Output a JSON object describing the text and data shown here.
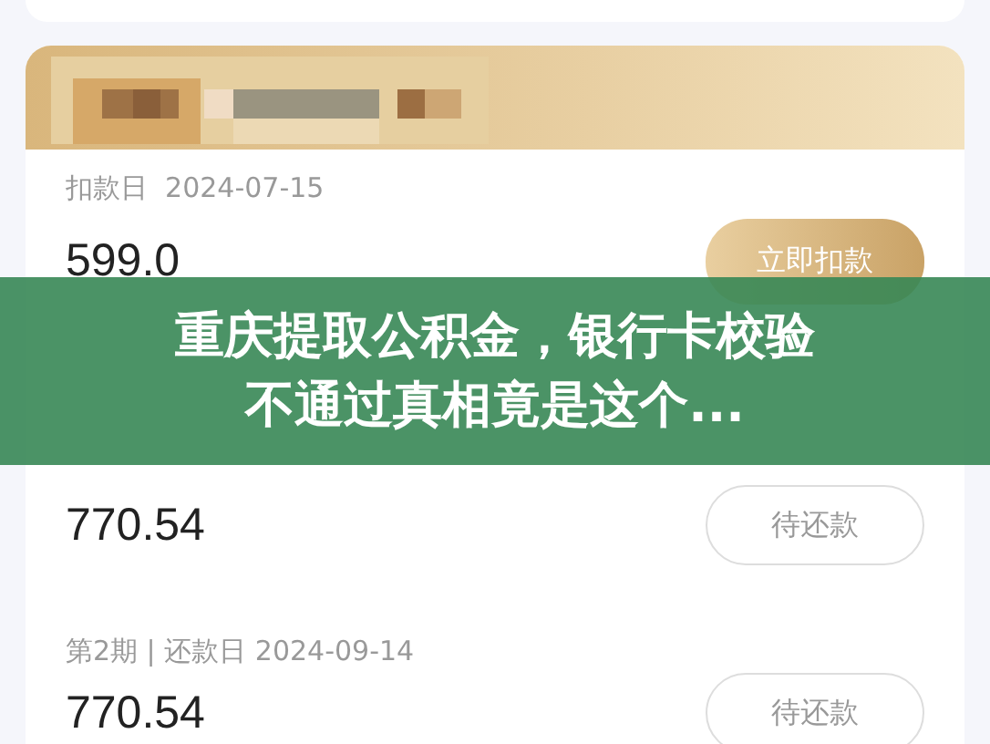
{
  "deduction": {
    "label": "扣款日",
    "date": "2024-07-15",
    "amount": "599.0",
    "button": "立即扣款"
  },
  "installments": [
    {
      "amount": "770.54",
      "status": "待还款"
    },
    {
      "label": "第2期 | 还款日 2024-09-14",
      "amount": "770.54",
      "status": "待还款"
    }
  ],
  "banner": {
    "lines": [
      "重庆提取公积金，银行卡校验",
      "不通过真相竟是这个..."
    ]
  }
}
